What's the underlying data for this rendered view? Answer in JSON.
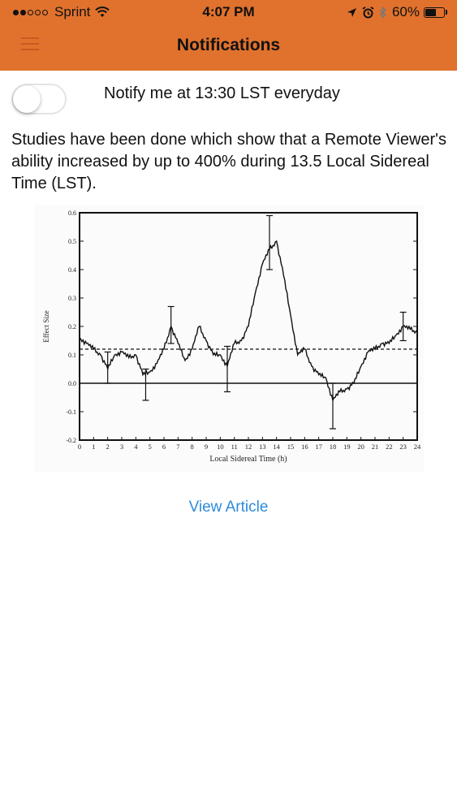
{
  "status_bar": {
    "carrier": "Sprint",
    "signal_bars_filled": 2,
    "signal_bars_total": 5,
    "time": "4:07 PM",
    "battery_percent": "60%",
    "battery_level": 0.6
  },
  "nav": {
    "title": "Notifications",
    "menu_icon": "hamburger-menu-icon"
  },
  "notification": {
    "toggle_on": false,
    "label": "Notify me at 13:30 LST everyday"
  },
  "intro_text": "Studies have been done which show that a Remote Viewer's ability increased by up to 400% during 13.5 Local Sidereal Time (LST).",
  "chart_data": {
    "type": "line",
    "title": "",
    "xlabel": "Local Sidereal Time (h)",
    "ylabel": "Effect Size",
    "xlim": [
      0,
      24
    ],
    "ylim": [
      -0.2,
      0.6
    ],
    "x_ticks": [
      "0",
      "1",
      "2",
      "3",
      "4",
      "5",
      "6",
      "7",
      "8",
      "9",
      "10",
      "11",
      "12",
      "13",
      "14",
      "15",
      "16",
      "17",
      "18",
      "19",
      "20",
      "21",
      "22",
      "23",
      "24"
    ],
    "y_ticks": [
      "0.6",
      "0.5",
      "0.4",
      "0.3",
      "0.2",
      "0.1",
      "0.0",
      "-0.1",
      "-0.2"
    ],
    "grid": false,
    "reference_lines": [
      {
        "y": 0.12,
        "style": "dashed"
      },
      {
        "y": 0.0,
        "style": "solid"
      }
    ],
    "series": [
      {
        "x": [
          0,
          0.5,
          1,
          1.5,
          2,
          2.5,
          3,
          3.5,
          4,
          4.5,
          5,
          5.5,
          6,
          6.5,
          7,
          7.5,
          8,
          8.5,
          9,
          9.5,
          10,
          10.5,
          11,
          11.5,
          12,
          12.5,
          13,
          13.5,
          14,
          14.5,
          15,
          15.5,
          16,
          16.5,
          17,
          17.5,
          18,
          18.5,
          19,
          19.5,
          20,
          20.5,
          21,
          21.5,
          22,
          22.5,
          23,
          23.5,
          24
        ],
        "y": [
          0.16,
          0.14,
          0.12,
          0.1,
          0.05,
          0.1,
          0.11,
          0.09,
          0.1,
          0.03,
          0.04,
          0.07,
          0.12,
          0.2,
          0.14,
          0.08,
          0.12,
          0.2,
          0.15,
          0.1,
          0.1,
          0.06,
          0.14,
          0.15,
          0.2,
          0.32,
          0.42,
          0.47,
          0.5,
          0.38,
          0.24,
          0.1,
          0.12,
          0.06,
          0.03,
          0.02,
          -0.06,
          -0.03,
          -0.02,
          0.0,
          0.06,
          0.11,
          0.12,
          0.14,
          0.14,
          0.17,
          0.2,
          0.19,
          0.18
        ]
      }
    ],
    "error_bars": [
      {
        "x": 2,
        "y": 0.05,
        "low": 0.0,
        "high": 0.11
      },
      {
        "x": 4.7,
        "y": 0.03,
        "low": -0.06,
        "high": 0.05
      },
      {
        "x": 6.5,
        "y": 0.2,
        "low": 0.14,
        "high": 0.27
      },
      {
        "x": 10.5,
        "y": 0.06,
        "low": -0.03,
        "high": 0.13
      },
      {
        "x": 13.5,
        "y": 0.49,
        "low": 0.4,
        "high": 0.59
      },
      {
        "x": 18,
        "y": -0.06,
        "low": -0.16,
        "high": 0.0
      },
      {
        "x": 23,
        "y": 0.2,
        "low": 0.15,
        "high": 0.25
      }
    ]
  },
  "view_article_label": "View Article",
  "colors": {
    "header": "#e1722d",
    "link": "#2f8bdb"
  }
}
